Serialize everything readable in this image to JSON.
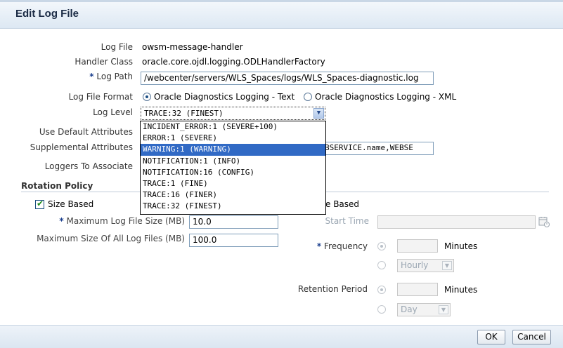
{
  "dialog": {
    "title": "Edit Log File"
  },
  "fields": {
    "log_file": {
      "label": "Log File",
      "value": "owsm-message-handler"
    },
    "handler_class": {
      "label": "Handler Class",
      "value": "oracle.core.ojdl.logging.ODLHandlerFactory"
    },
    "log_path": {
      "required_marker": "*",
      "label": "Log Path",
      "value": "/webcenter/servers/WLS_Spaces/logs/WLS_Spaces-diagnostic.log"
    },
    "log_file_format": {
      "label": "Log File Format",
      "options": [
        "Oracle Diagnostics Logging - Text",
        "Oracle Diagnostics Logging - XML"
      ],
      "selected": "Oracle Diagnostics Logging - Text"
    },
    "log_level": {
      "label": "Log Level",
      "value": "TRACE:32 (FINEST)",
      "options": [
        "INCIDENT_ERROR:1 (SEVERE+100)",
        "ERROR:1 (SEVERE)",
        "WARNING:1 (WARNING)",
        "NOTIFICATION:1 (INFO)",
        "NOTIFICATION:16 (CONFIG)",
        "TRACE:1 (FINE)",
        "TRACE:16 (FINER)",
        "TRACE:32 (FINEST)"
      ],
      "highlighted": "WARNING:1 (WARNING)"
    },
    "use_default_attributes": {
      "label": "Use Default Attributes"
    },
    "supplemental_attributes": {
      "label": "Supplemental Attributes",
      "value_visible": "BSERVICE.name,WEBSE"
    },
    "loggers_to_associate": {
      "label": "Loggers To Associate"
    }
  },
  "rotation_policy": {
    "title": "Rotation Policy",
    "size_based": {
      "label": "Size Based",
      "checked": true,
      "max_log_file_size": {
        "required_marker": "*",
        "label": "Maximum Log File Size (MB)",
        "value": "10.0"
      },
      "max_size_all": {
        "label": "Maximum Size Of All Log Files (MB)",
        "value": "100.0"
      }
    },
    "time_based": {
      "label_visible": "e Based",
      "start_time": {
        "label": "Start Time",
        "value": ""
      },
      "frequency": {
        "required_marker": "*",
        "label": "Frequency",
        "minutes_unit": "Minutes",
        "minutes_value": "",
        "select_value": "Hourly"
      },
      "retention_period": {
        "label": "Retention Period",
        "minutes_unit": "Minutes",
        "minutes_value": "",
        "select_value": "Day"
      }
    }
  },
  "buttons": {
    "ok": "OK",
    "cancel": "Cancel"
  }
}
